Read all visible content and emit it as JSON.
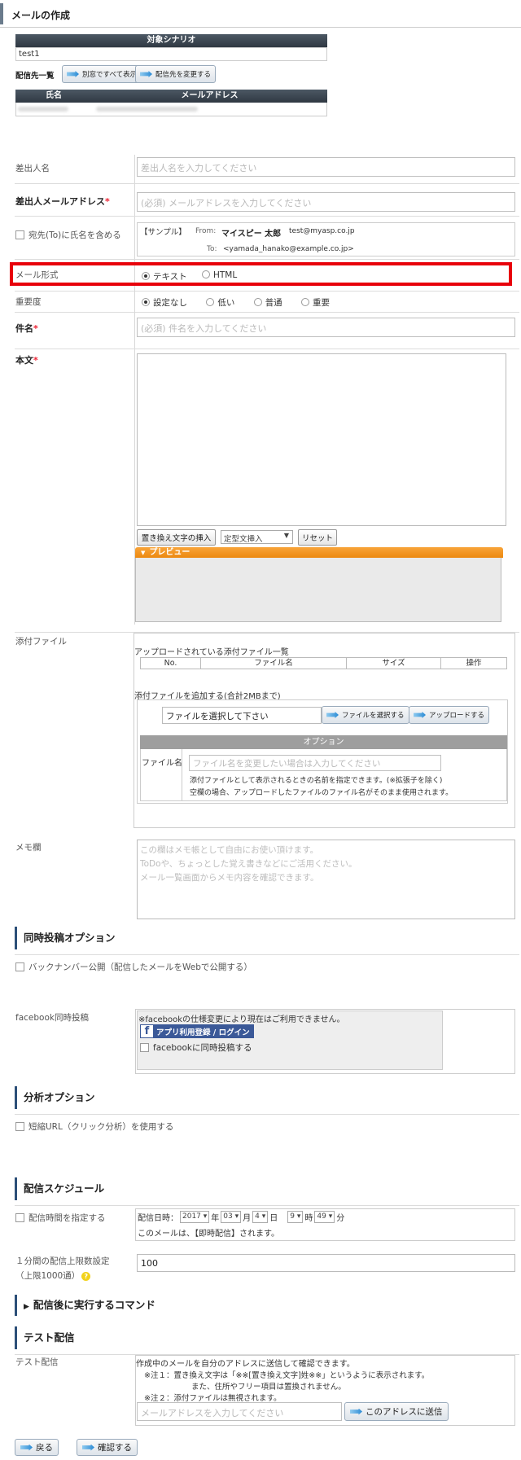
{
  "page": {
    "title": "メールの作成"
  },
  "scenario": {
    "header": "対象シナリオ",
    "value": "test1"
  },
  "recipients": {
    "label": "配信先一覧",
    "btn_all": "別窓ですべて表示",
    "btn_change": "配信先を変更する",
    "col_name": "氏名",
    "col_email": "メールアドレス"
  },
  "sender": {
    "name_label": "差出人名",
    "name_placeholder": "差出人名を入力してください",
    "email_label": "差出人メールアドレス",
    "email_required": "*",
    "email_placeholder": "(必須) メールアドレスを入力してください"
  },
  "to_name": {
    "label": "宛先(To)に氏名を含める",
    "sample": "【サンプル】",
    "from_label": "From:",
    "from_name": "マイスピー 太郎",
    "from_email": "test@myasp.co.jp",
    "to_label": "To:",
    "to_value": "<yamada_hanako@example.co.jp>"
  },
  "format": {
    "label": "メール形式",
    "opt_text": "テキスト",
    "opt_html": "HTML",
    "highlight_color": "#e8000b"
  },
  "priority": {
    "label": "重要度",
    "options": [
      "設定なし",
      "低い",
      "普通",
      "重要"
    ]
  },
  "subject": {
    "label": "件名",
    "required": "*",
    "placeholder": "(必須) 件名を入力してください"
  },
  "body": {
    "label": "本文",
    "required": "*",
    "btn_replace": "置き換え文字の挿入",
    "select_template": "定型文挿入",
    "btn_reset": "リセット",
    "preview": "プレビュー"
  },
  "attach": {
    "label": "添付ファイル",
    "list_title": "アップロードされている添付ファイル一覧",
    "cols": [
      "No.",
      "ファイル名",
      "サイズ",
      "操作"
    ],
    "add_title": "添付ファイルを追加する(合計2MBまで)",
    "file_placeholder": "ファイルを選択して下さい",
    "btn_select": "ファイルを選択する",
    "btn_upload": "アップロードする",
    "option": "オプション",
    "fname_label": "ファイル名",
    "fname_placeholder": "ファイル名を変更したい場合は入力してください",
    "note1": "添付ファイルとして表示されるときの名前を指定できます。(※拡張子を除く)",
    "note2": "空欄の場合、アップロードしたファイルのファイル名がそのまま使用されます。"
  },
  "memo": {
    "label": "メモ欄",
    "lines": [
      "この欄はメモ帳として自由にお使い頂けます。",
      "ToDoや、ちょっとした覚え書きなどにご活用ください。",
      "メール一覧画面からメモ内容を確認できます。"
    ]
  },
  "simul": {
    "title": "同時投稿オプション",
    "backnumber": "バックナンバー公開（配信したメールをWebで公開する）",
    "fb_label": "facebook同時投稿",
    "fb_note": "※facebookの仕様変更により現在はご利用できません。",
    "fb_btn": "アプリ利用登録 / ログイン",
    "fb_check": "facebookに同時投稿する"
  },
  "analysis": {
    "title": "分析オプション",
    "short_url": "短縮URL（クリック分析）を使用する"
  },
  "schedule": {
    "title": "配信スケジュール",
    "time_label": "配信時間を指定する",
    "date_label": "配信日時：",
    "year": "2017",
    "y": "年",
    "month": "03",
    "m": "月",
    "day": "4",
    "d": "日",
    "hour": "9",
    "h": "時",
    "minute": "49",
    "mi": "分",
    "note": "このメールは、【即時配信】されます。",
    "limit_label": "１分間の配信上限数設定",
    "limit_sub": "（上限1000通）",
    "limit_value": "100"
  },
  "command": {
    "title": "配信後に実行するコマンド"
  },
  "test": {
    "title": "テスト配信",
    "label": "テスト配信",
    "line1": "作成中のメールを自分のアドレスに送信して確認できます。",
    "line2": "※注１：置き換え文字は「※※[置き換え文字]姓※※」というように表示されます。",
    "line3": "また、住所やフリー項目は置換されません。",
    "line4": "※注２：添付ファイルは無視されます。",
    "placeholder": "メールアドレスを入力してください",
    "send": "このアドレスに送信"
  },
  "footer": {
    "back": "戻る",
    "confirm": "確認する"
  }
}
